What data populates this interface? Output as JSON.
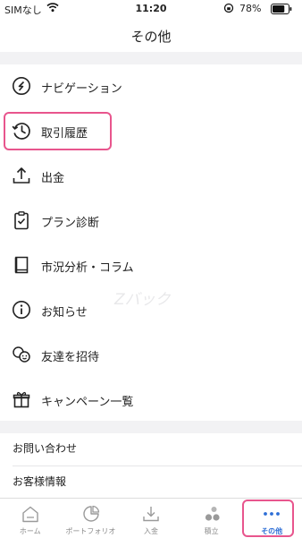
{
  "status_bar": {
    "carrier": "SIMなし",
    "time": "11:20",
    "battery": "78%",
    "battery_level": 0.78
  },
  "header": {
    "title": "その他"
  },
  "menu": {
    "items": [
      {
        "label": "ナビゲーション",
        "icon": "compass-icon"
      },
      {
        "label": "取引履歴",
        "icon": "history-icon",
        "highlighted": true
      },
      {
        "label": "出金",
        "icon": "upload-icon"
      },
      {
        "label": "プラン診断",
        "icon": "clipboard-check-icon"
      },
      {
        "label": "市況分析・コラム",
        "icon": "book-icon"
      },
      {
        "label": "お知らせ",
        "icon": "info-icon"
      },
      {
        "label": "友達を招待",
        "icon": "friends-icon"
      },
      {
        "label": "キャンペーン一覧",
        "icon": "gift-icon"
      }
    ]
  },
  "links": {
    "items": [
      {
        "label": "お問い合わせ"
      },
      {
        "label": "お客様情報"
      }
    ]
  },
  "watermark": "Zバック",
  "tab_bar": {
    "tabs": [
      {
        "label": "ホーム",
        "icon": "home-icon"
      },
      {
        "label": "ポートフォリオ",
        "icon": "portfolio-icon"
      },
      {
        "label": "入金",
        "icon": "deposit-icon"
      },
      {
        "label": "積立",
        "icon": "savings-icon"
      },
      {
        "label": "その他",
        "icon": "more-icon",
        "active": true
      }
    ]
  },
  "colors": {
    "accent": "#2d6ed6",
    "highlight": "#e8558d",
    "background": "#f2f2f4",
    "icon": "#222222",
    "inactive": "#8a8a8a"
  }
}
